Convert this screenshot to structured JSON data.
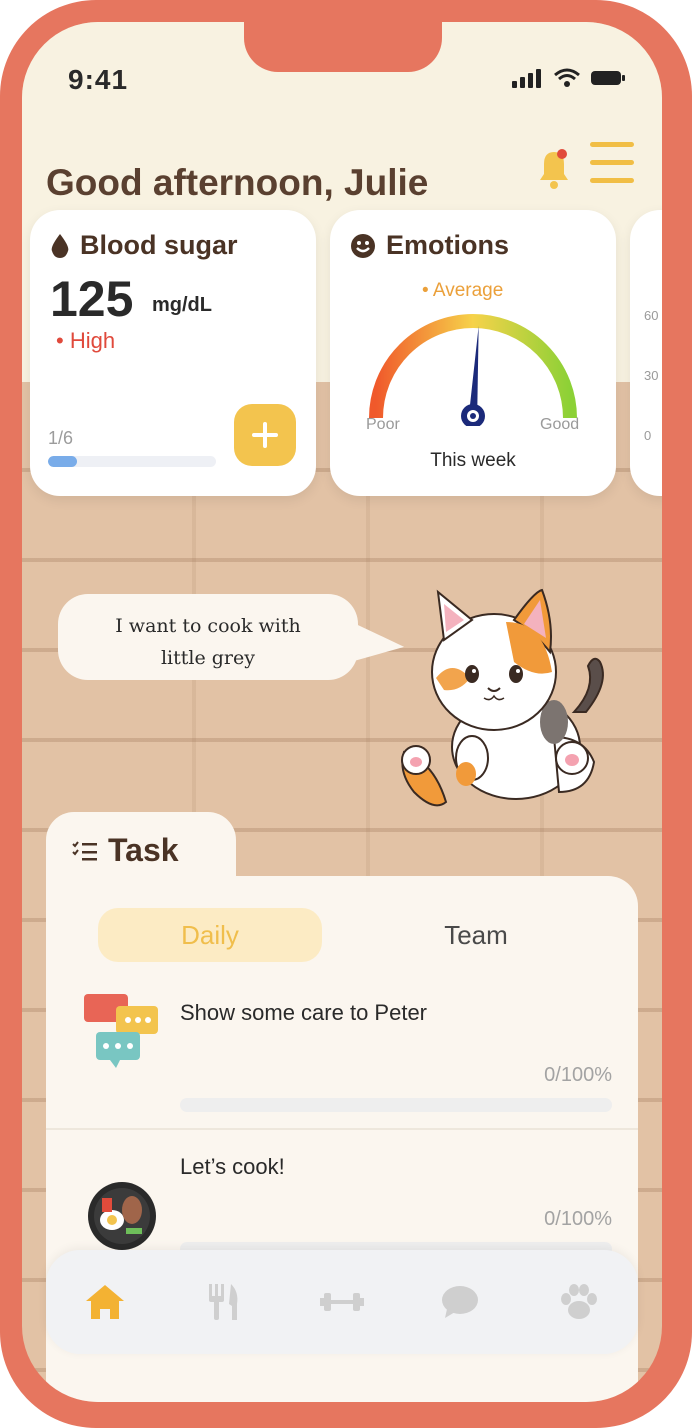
{
  "status": {
    "time": "9:41"
  },
  "header": {
    "greeting": "Good afternoon, Julie"
  },
  "blood_sugar": {
    "title": "Blood sugar",
    "value": "125",
    "unit": "mg/dL",
    "level": "• High",
    "progress_label": "1/6",
    "progress": 0.17
  },
  "emotions": {
    "title": "Emotions",
    "current": "• Average",
    "poor_label": "Poor",
    "good_label": "Good",
    "period": "This week",
    "gauge_level": 0.52
  },
  "third_card": {
    "axis": [
      "60",
      "30",
      "0"
    ]
  },
  "pet": {
    "speech": "I want to cook with little grey",
    "speech_line1": "I want to cook with",
    "speech_line2": "little grey"
  },
  "task": {
    "title": "Task",
    "tabs": [
      {
        "label": "Daily",
        "selected": true
      },
      {
        "label": "Team",
        "selected": false
      }
    ],
    "items": [
      {
        "name": "Show some care to Peter",
        "progress": "0/100%",
        "icon": "chat-bubbles-icon"
      },
      {
        "name": "Let’s cook!",
        "progress": "0/100%",
        "icon": "food-pan-icon"
      }
    ]
  },
  "nav": {
    "items": [
      "home-icon",
      "fork-knife-icon",
      "dumbbell-icon",
      "chat-icon",
      "paw-icon"
    ],
    "active_color": "#F3B233",
    "inactive_color": "#CFCFCF"
  },
  "colors": {
    "accent": "#F3C44E",
    "frame": "#E6765F",
    "text_brown": "#4A3325",
    "high": "#E04A3C"
  }
}
